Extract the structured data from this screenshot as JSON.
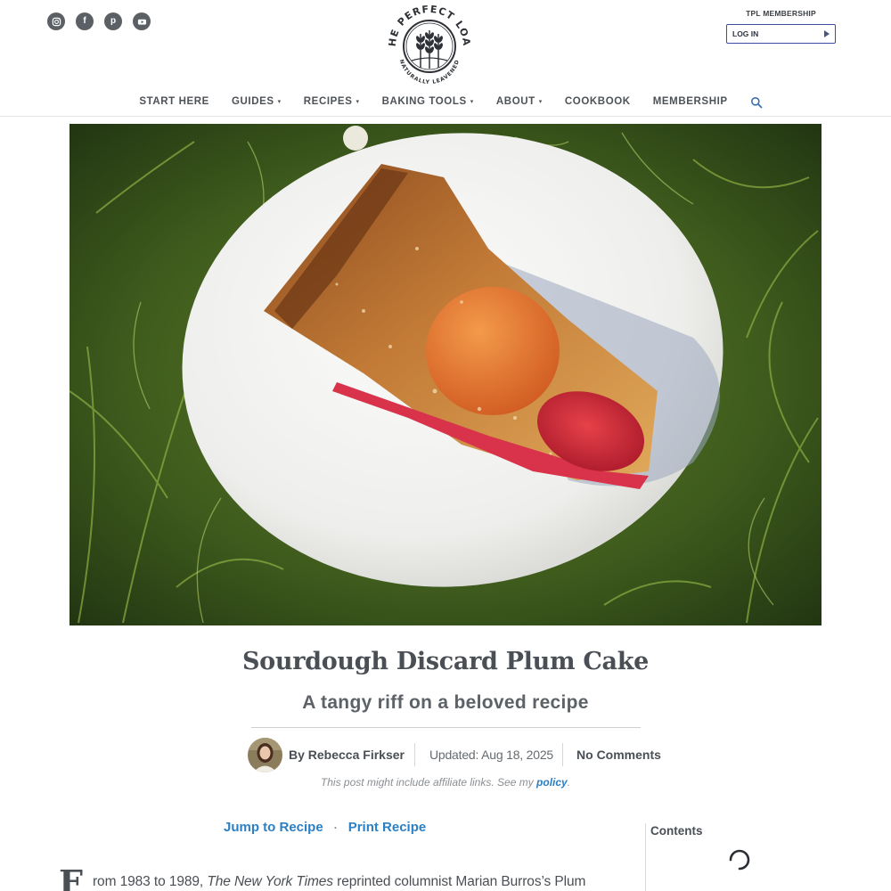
{
  "social": [
    {
      "icon": "instagram-icon"
    },
    {
      "icon": "facebook-icon",
      "glyph": "f"
    },
    {
      "icon": "pinterest-icon",
      "glyph": "p"
    },
    {
      "icon": "youtube-icon"
    }
  ],
  "logo": {
    "top_text": "THE PERFECT LOAF",
    "bottom_text": "NATURALLY LEAVENED"
  },
  "membership": {
    "title": "TPL MEMBERSHIP",
    "login_label": "LOG IN"
  },
  "nav": {
    "items": [
      {
        "label": "START HERE",
        "dropdown": false
      },
      {
        "label": "GUIDES",
        "dropdown": true
      },
      {
        "label": "RECIPES",
        "dropdown": true
      },
      {
        "label": "BAKING TOOLS",
        "dropdown": true
      },
      {
        "label": "ABOUT",
        "dropdown": true
      },
      {
        "label": "COOKBOOK",
        "dropdown": false
      },
      {
        "label": "MEMBERSHIP",
        "dropdown": false
      }
    ],
    "caret": "▾",
    "search_icon": "search-icon"
  },
  "post": {
    "title": "Sourdough Discard Plum Cake",
    "subtitle": "A tangy riff on a beloved recipe",
    "byline": "By Rebecca Firkser",
    "updated": "Updated: Aug 18, 2025",
    "comments": "No Comments",
    "affiliate_text": "This post might include affiliate links. See my",
    "affiliate_link": "policy",
    "affiliate_end": ".",
    "jump_to_recipe": "Jump to Recipe",
    "separator": "·",
    "print_recipe": "Print Recipe",
    "drop_cap": "F",
    "intro_prefix": "rom 1983 to 1989, ",
    "intro_italic": "The New York Times",
    "intro_suffix": " reprinted columnist Marian Burros’s Plum"
  },
  "sidebar": {
    "contents_title": "Contents"
  },
  "colors": {
    "link": "#2c80c4",
    "text": "#4a4f55",
    "social_bg": "#5b6066",
    "login_border": "#3d4ea0"
  }
}
